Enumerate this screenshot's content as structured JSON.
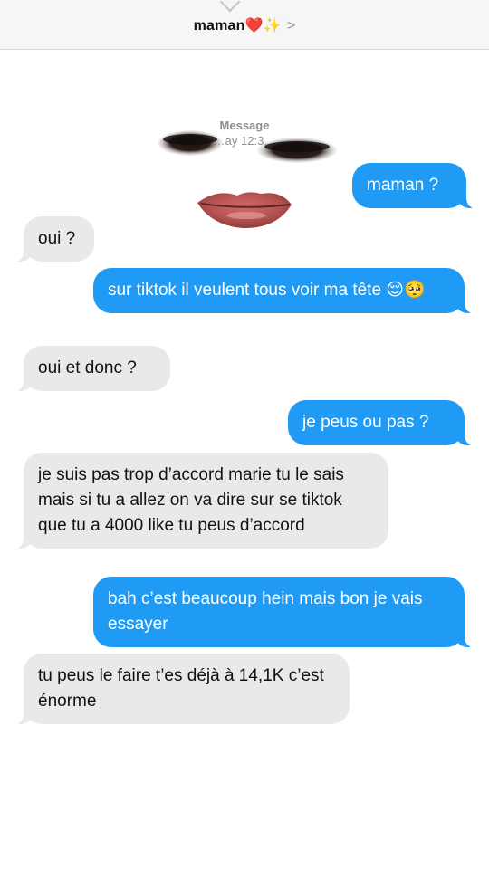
{
  "header": {
    "contact_name": "maman",
    "contact_emojis": "❤️✨",
    "chevron": ">"
  },
  "thread_meta": {
    "label": "Message",
    "timestamp": "…ay 12:3…"
  },
  "overlay": {
    "description_icon": "face-sticker-icon"
  },
  "messages": [
    {
      "from": "me",
      "text": "maman ?"
    },
    {
      "from": "them",
      "text": "oui ?"
    },
    {
      "from": "me",
      "text": "sur tiktok il veulent tous voir ma tête 😌🥺"
    },
    {
      "from": "them",
      "text": "oui et donc ?"
    },
    {
      "from": "me",
      "text": "je peus ou pas ?"
    },
    {
      "from": "them",
      "text": "je suis pas trop d’accord marie tu le sais mais si tu a allez on va dire sur se tiktok que tu a 4000 like tu peus d’accord"
    },
    {
      "from": "me",
      "text": "bah c’est beaucoup hein mais bon je vais essayer"
    },
    {
      "from": "them",
      "text": "tu peus le faire t’es déjà à 14,1K c’est énorme"
    }
  ],
  "colors": {
    "sent_bubble": "#1f9bf5",
    "received_bubble": "#e9e9eb",
    "meta_text": "#8e8e93"
  }
}
